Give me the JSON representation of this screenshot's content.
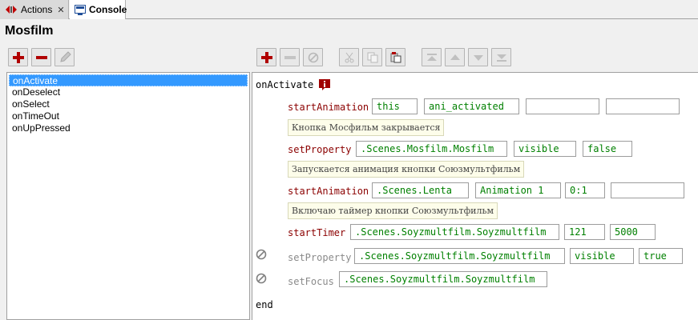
{
  "tabs": [
    {
      "label": "Actions",
      "icon": "actions-icon"
    },
    {
      "label": "Console",
      "icon": "console-icon"
    }
  ],
  "title": "Mosfilm",
  "left_toolbar": [
    "add-icon",
    "remove-icon",
    "edit-icon"
  ],
  "right_toolbar": [
    "add-icon",
    "remove-icon",
    "disable-icon",
    "cut-icon",
    "copy-icon",
    "paste-icon",
    "move-top-icon",
    "move-up-icon",
    "move-down-icon",
    "move-bottom-icon"
  ],
  "events": [
    "onActivate",
    "onDeselect",
    "onSelect",
    "onTimeOut",
    "onUpPressed"
  ],
  "selected_event": "onActivate",
  "editor": {
    "header": "onActivate",
    "footer": "end",
    "lines": [
      {
        "command": "startAnimation",
        "args": [
          "this",
          "ani_activated",
          "",
          ""
        ]
      },
      {
        "comment": "Кнопка Мосфильм закрывается"
      },
      {
        "command": "setProperty",
        "args": [
          ".Scenes.Mosfilm.Mosfilm",
          "visible",
          "false"
        ]
      },
      {
        "comment": "Запускается анимация кнопки Союзмультфильм"
      },
      {
        "command": "startAnimation",
        "args": [
          ".Scenes.Lenta",
          "Animation 1",
          "0:1",
          ""
        ]
      },
      {
        "comment": "Включаю таймер кнопки Союзмультфильм"
      },
      {
        "command": "startTimer",
        "args": [
          ".Scenes.Soyzmultfilm.Soyzmultfilm",
          "121",
          "5000"
        ]
      },
      {
        "command": "setProperty",
        "disabled": true,
        "args": [
          ".Scenes.Soyzmultfilm.Soyzmultfilm",
          "visible",
          "true"
        ]
      },
      {
        "command": "setFocus",
        "disabled": true,
        "args": [
          ".Scenes.Soyzmultfilm.Soyzmultfilm"
        ]
      }
    ]
  },
  "colors": {
    "command": "#8b0000",
    "argument": "#008000",
    "selection": "#3399ff",
    "comment_bg": "#fdfdea"
  }
}
